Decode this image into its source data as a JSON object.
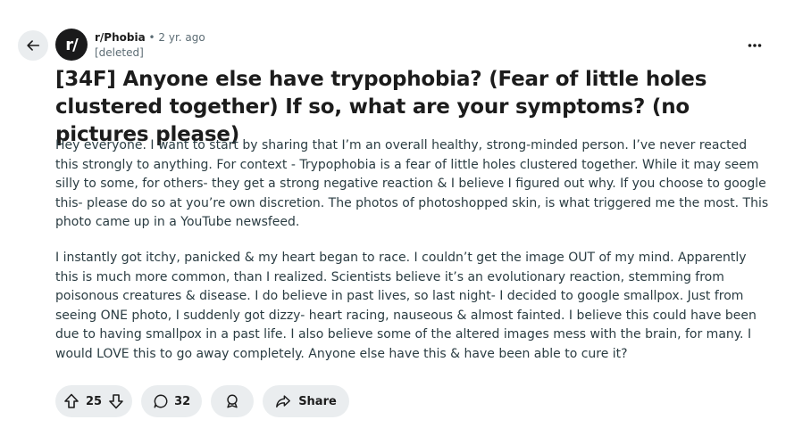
{
  "header": {
    "subreddit": "r/Phobia",
    "separator": "•",
    "age": "2 yr. ago",
    "author": "[deleted]",
    "avatar_text": "r/"
  },
  "post": {
    "title": "[34F] Anyone else have trypophobia? (Fear of little holes clustered together) If so, what are your symptoms? (no pictures please)",
    "paragraphs": [
      "Hey everyone. I want to start by sharing that I’m an overall healthy, strong-minded person. I’ve never reacted this strongly to anything. For context - Trypophobia is a fear of little holes clustered together. While it may seem silly to some, for others- they get a strong negative reaction & I believe I figured out why. If you choose to google this- please do so at you’re own discretion. The photos of photoshopped skin, is what triggered me the most. This photo came up in a YouTube newsfeed.",
      "I instantly got itchy, panicked & my heart began to race. I couldn’t get the image OUT of my mind. Apparently this is much more common, than I realized. Scientists believe it’s an evolutionary reaction, stemming from poisonous creatures & disease. I do believe in past lives, so last night- I decided to google smallpox. Just from seeing ONE photo, I suddenly got dizzy- heart racing, nauseous & almost fainted. I believe this could have been due to having smallpox in a past life. I also believe some of the altered images mess with the brain, for many. I would LOVE this to go away completely. Anyone else have this & have been able to cure it?"
    ]
  },
  "actions": {
    "vote_count": "25",
    "comment_count": "32",
    "share_label": "Share"
  },
  "icons": {
    "back": "arrow-left-icon",
    "more": "more-horizontal-icon",
    "upvote": "upvote-arrow-icon",
    "downvote": "downvote-arrow-icon",
    "comment": "comment-bubble-icon",
    "award": "award-icon",
    "share": "share-arrow-icon"
  }
}
